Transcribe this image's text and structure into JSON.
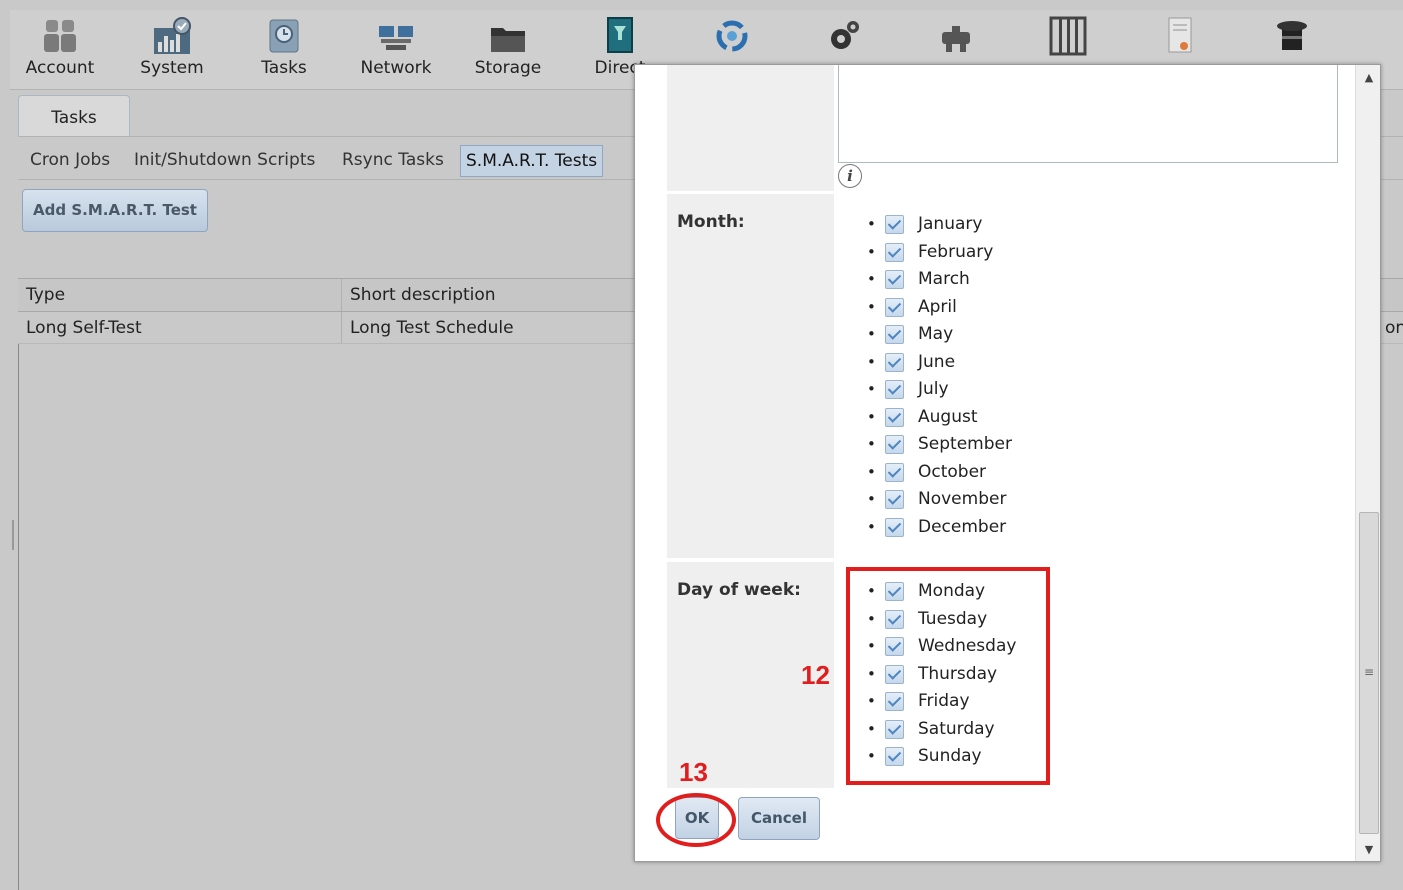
{
  "toolbar": {
    "items": [
      {
        "label": "Account",
        "icon": "account-icon"
      },
      {
        "label": "System",
        "icon": "system-icon"
      },
      {
        "label": "Tasks",
        "icon": "tasks-icon"
      },
      {
        "label": "Network",
        "icon": "network-icon"
      },
      {
        "label": "Storage",
        "icon": "storage-icon"
      },
      {
        "label": "Direct",
        "icon": "directory-icon"
      },
      {
        "label": "",
        "icon": "sharing-icon"
      },
      {
        "label": "",
        "icon": "services-icon"
      },
      {
        "label": "",
        "icon": "plugins-icon"
      },
      {
        "label": "",
        "icon": "jails-icon"
      },
      {
        "label": "",
        "icon": "reporting-icon"
      },
      {
        "label": "",
        "icon": "wizard-icon"
      }
    ]
  },
  "tasks": {
    "tab_label": "Tasks",
    "subtabs": [
      "Cron Jobs",
      "Init/Shutdown Scripts",
      "Rsync Tasks",
      "S.M.A.R.T. Tests"
    ],
    "active_subtab": "S.M.A.R.T. Tests",
    "add_button": "Add S.M.A.R.T. Test",
    "columns": [
      "Type",
      "Short description"
    ],
    "rows": [
      {
        "type": "Long Self-Test",
        "description": "Long Test Schedule",
        "extra": "on"
      }
    ]
  },
  "dialog": {
    "month_label": "Month:",
    "months": [
      "January",
      "February",
      "March",
      "April",
      "May",
      "June",
      "July",
      "August",
      "September",
      "October",
      "November",
      "December"
    ],
    "day_label": "Day of week:",
    "days": [
      "Monday",
      "Tuesday",
      "Wednesday",
      "Thursday",
      "Friday",
      "Saturday",
      "Sunday"
    ],
    "ok_label": "OK",
    "cancel_label": "Cancel",
    "info_glyph": "i"
  },
  "annotations": {
    "step_12": "12",
    "step_13": "13",
    "color": "#e01e1e"
  }
}
